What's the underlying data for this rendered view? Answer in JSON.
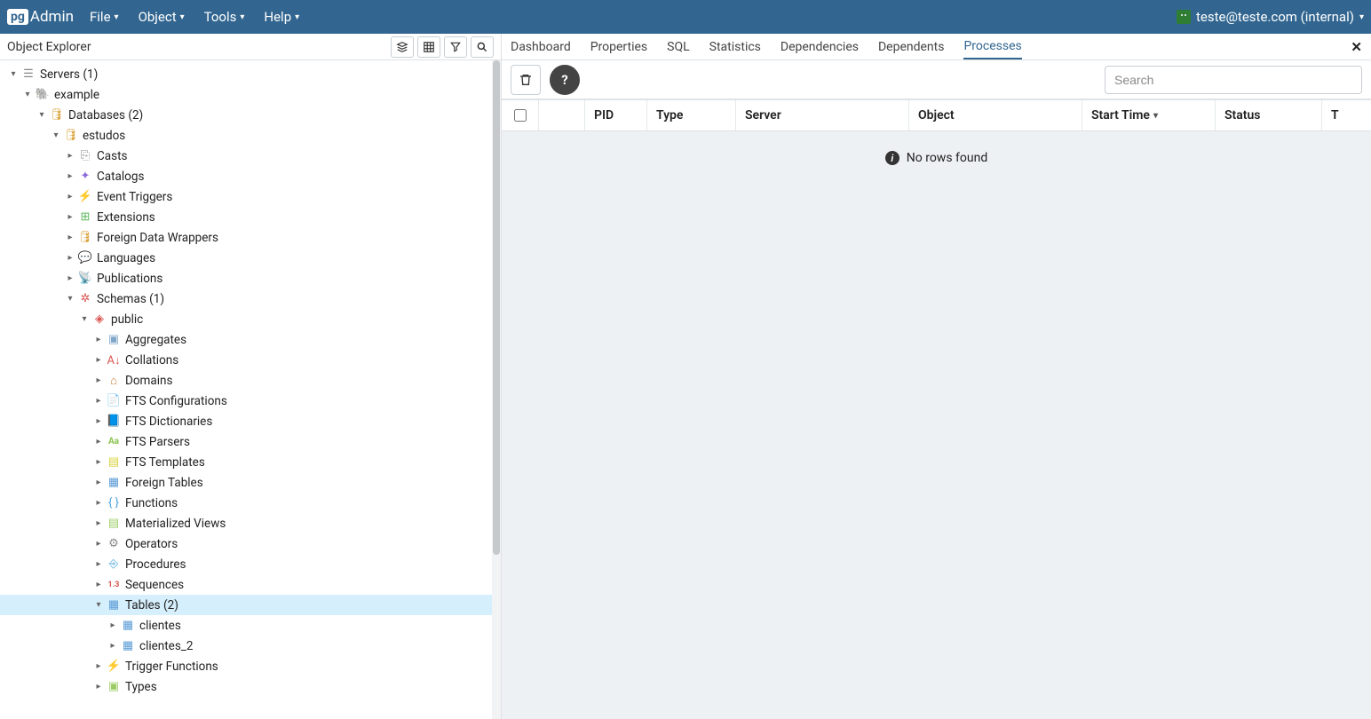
{
  "brand": {
    "badge": "pg",
    "name": "Admin"
  },
  "menubar": {
    "items": [
      "File",
      "Object",
      "Tools",
      "Help"
    ],
    "user": "teste@teste.com (internal)"
  },
  "object_explorer": {
    "title": "Object Explorer",
    "toolbar_icons": [
      "layers-icon",
      "grid-icon",
      "filter-icon",
      "search-icon"
    ]
  },
  "tree": {
    "servers": "Servers (1)",
    "server_name": "example",
    "databases": "Databases (2)",
    "db_name": "estudos",
    "children": {
      "casts": "Casts",
      "catalogs": "Catalogs",
      "event_triggers": "Event Triggers",
      "extensions": "Extensions",
      "fdw": "Foreign Data Wrappers",
      "languages": "Languages",
      "publications": "Publications",
      "schemas": "Schemas (1)",
      "schema_public": "public",
      "aggregates": "Aggregates",
      "collations": "Collations",
      "domains": "Domains",
      "fts_conf": "FTS Configurations",
      "fts_dict": "FTS Dictionaries",
      "fts_pars": "FTS Parsers",
      "fts_temp": "FTS Templates",
      "foreign_tables": "Foreign Tables",
      "functions": "Functions",
      "mat_views": "Materialized Views",
      "operators": "Operators",
      "procedures": "Procedures",
      "sequences": "Sequences",
      "tables": "Tables (2)",
      "table1": "clientes",
      "table2": "clientes_2",
      "trigger_funcs": "Trigger Functions",
      "types": "Types"
    }
  },
  "right_panel": {
    "tabs": {
      "dashboard": "Dashboard",
      "properties": "Properties",
      "sql": "SQL",
      "statistics": "Statistics",
      "dependencies": "Dependencies",
      "dependents": "Dependents",
      "processes": "Processes"
    },
    "search_placeholder": "Search",
    "columns": {
      "pid": "PID",
      "type": "Type",
      "server": "Server",
      "object": "Object",
      "start_time": "Start Time",
      "status": "Status",
      "last_partial": "T"
    },
    "empty_text": "No rows found"
  }
}
